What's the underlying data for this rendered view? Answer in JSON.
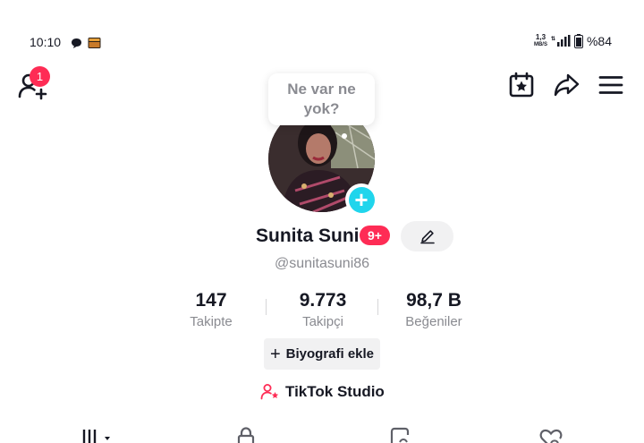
{
  "status_bar": {
    "time": "10:10",
    "speed_value": "1,3",
    "speed_unit": "MB/S",
    "network": "4G",
    "battery": "%84"
  },
  "header": {
    "notification_count": "1",
    "icons": [
      "add-user-icon",
      "calendar-star-icon",
      "share-icon",
      "menu-icon"
    ]
  },
  "tooltip": {
    "line1": "Ne var ne",
    "line2": "yok?"
  },
  "profile": {
    "name": "Sunita Suni",
    "badge": "9+",
    "username": "@sunitasuni86"
  },
  "stats": [
    {
      "value": "147",
      "label": "Takipte"
    },
    {
      "value": "9.773",
      "label": "Takipçi"
    },
    {
      "value": "98,7 B",
      "label": "Beğeniler"
    }
  ],
  "bio_button": {
    "label": "Biyografi ekle"
  },
  "studio": {
    "label": "TikTok Studio"
  },
  "colors": {
    "accent": "#fe2c55",
    "avatar_add": "#20d5ec",
    "text_secondary": "#8a8b91"
  }
}
